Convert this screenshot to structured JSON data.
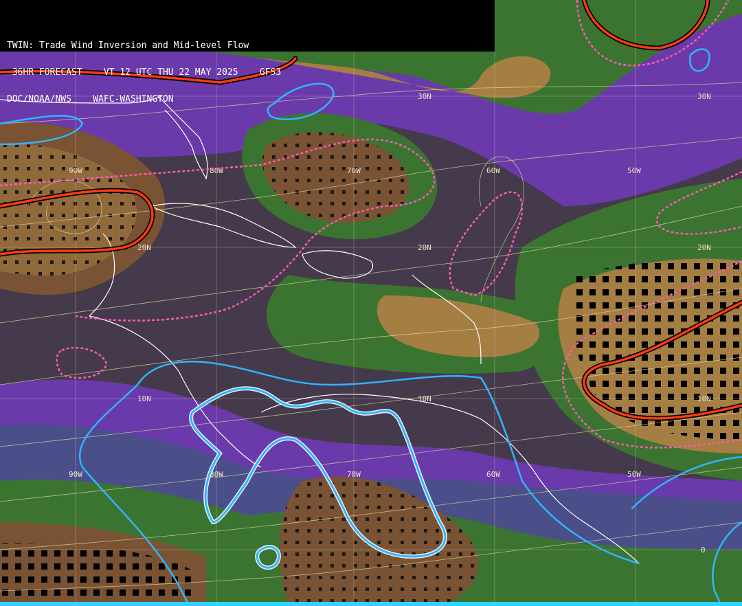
{
  "header": {
    "line1": "TWIN: Trade Wind Inversion and Mid-level Flow",
    "line2": " 36HR FORECAST    VT 12 UTC THU 22 MAY 2025    GFS3",
    "line3": "DOC/NOAA/NWS    WAFC-WASHINGTON"
  },
  "map": {
    "background": "#453a4b",
    "colors": {
      "dry_brown": "#7a5334",
      "tan": "#a47e43",
      "green": "#3b7431",
      "purple": "#6a3aaa",
      "slate": "#4a4f8a",
      "grid": "#d9d2b3",
      "streamline": "#e8dca2",
      "coast": "#ffffff",
      "red_contour": "#ff3b12",
      "pink_contour": "#ff5ab4",
      "cyan_contour": "#32b4ff"
    },
    "labels": {
      "lat": [
        "30N",
        "30N",
        "20N",
        "20N",
        "20N",
        "10N",
        "10N",
        "10N",
        "0"
      ],
      "lon": [
        "90W",
        "80W",
        "70W",
        "60W",
        "50W",
        "90W",
        "80W",
        "70W",
        "60W",
        "50W"
      ]
    }
  }
}
